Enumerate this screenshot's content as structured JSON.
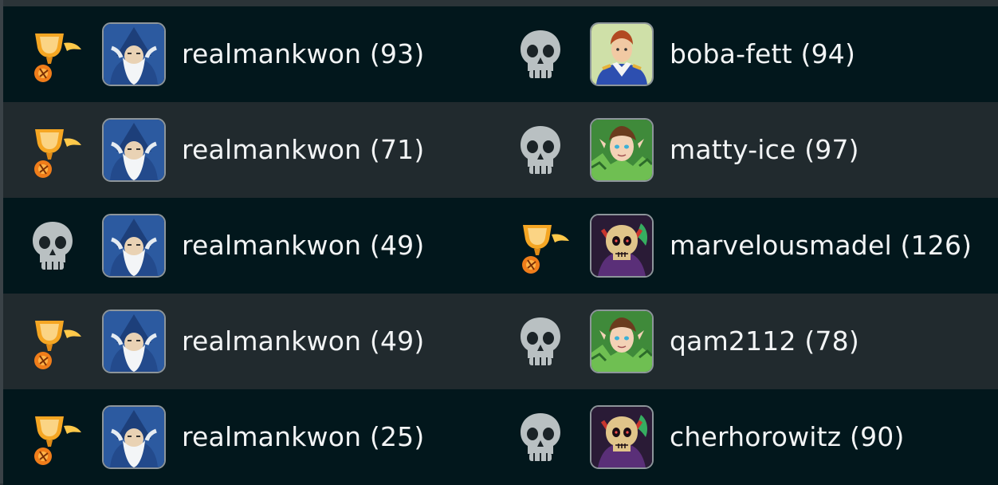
{
  "results": [
    {
      "left": {
        "name": "realmankwon (93)",
        "outcome": "win",
        "status_icon": "trophy-icon",
        "avatar": "wizard-avatar"
      },
      "right": {
        "name": "boba-fett (94)",
        "outcome": "loss",
        "status_icon": "skull-icon",
        "avatar": "knight-avatar"
      }
    },
    {
      "left": {
        "name": "realmankwon (71)",
        "outcome": "win",
        "status_icon": "trophy-icon",
        "avatar": "wizard-avatar"
      },
      "right": {
        "name": "matty-ice (97)",
        "outcome": "loss",
        "status_icon": "skull-icon",
        "avatar": "elf-avatar"
      }
    },
    {
      "left": {
        "name": "realmankwon (49)",
        "outcome": "loss",
        "status_icon": "skull-icon",
        "avatar": "wizard-avatar"
      },
      "right": {
        "name": "marvelousmadel (126)",
        "outcome": "win",
        "status_icon": "trophy-icon",
        "avatar": "skull-demon-avatar"
      }
    },
    {
      "left": {
        "name": "realmankwon (49)",
        "outcome": "win",
        "status_icon": "trophy-icon",
        "avatar": "wizard-avatar"
      },
      "right": {
        "name": "qam2112 (78)",
        "outcome": "loss",
        "status_icon": "skull-icon",
        "avatar": "elf-avatar"
      }
    },
    {
      "left": {
        "name": "realmankwon (25)",
        "outcome": "win",
        "status_icon": "trophy-icon",
        "avatar": "wizard-avatar"
      },
      "right": {
        "name": "cherhorowitz (90)",
        "outcome": "loss",
        "status_icon": "skull-icon",
        "avatar": "skull-demon-avatar"
      }
    }
  ],
  "colors": {
    "row_dark": "#02171c",
    "row_light": "#212a2e",
    "text": "#f2f4f5",
    "skull": "#b9c0c2",
    "trophy": "#f5a623"
  }
}
